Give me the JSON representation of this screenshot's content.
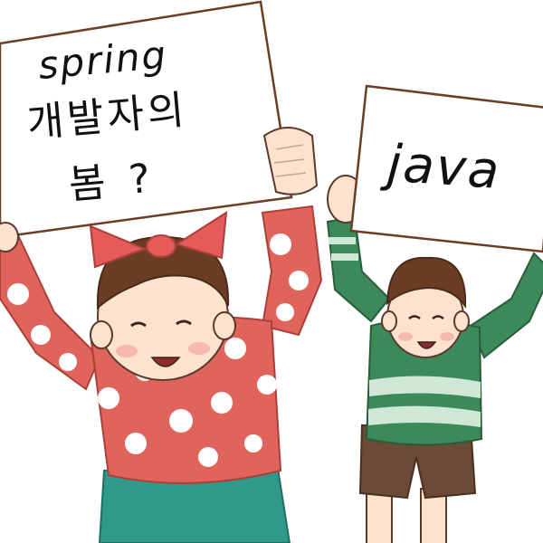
{
  "sign_left": {
    "line1": "spring",
    "line2": "개발자의",
    "line3": "봄 ?"
  },
  "sign_right": {
    "text": "java"
  },
  "colors": {
    "girl_sweater": "#e0645b",
    "girl_polka_dots": "#ffffff",
    "girl_skirt": "#2f9a8c",
    "girl_bow": "#e65a5a",
    "boy_sweater": "#3c8a5a",
    "boy_stripes": "#cfe7d6",
    "boy_shorts": "#6b4a36",
    "hair": "#6b3d24",
    "skin": "#fde3cf",
    "sign_paper": "#ffffff",
    "outline": "#5a3a2a"
  }
}
